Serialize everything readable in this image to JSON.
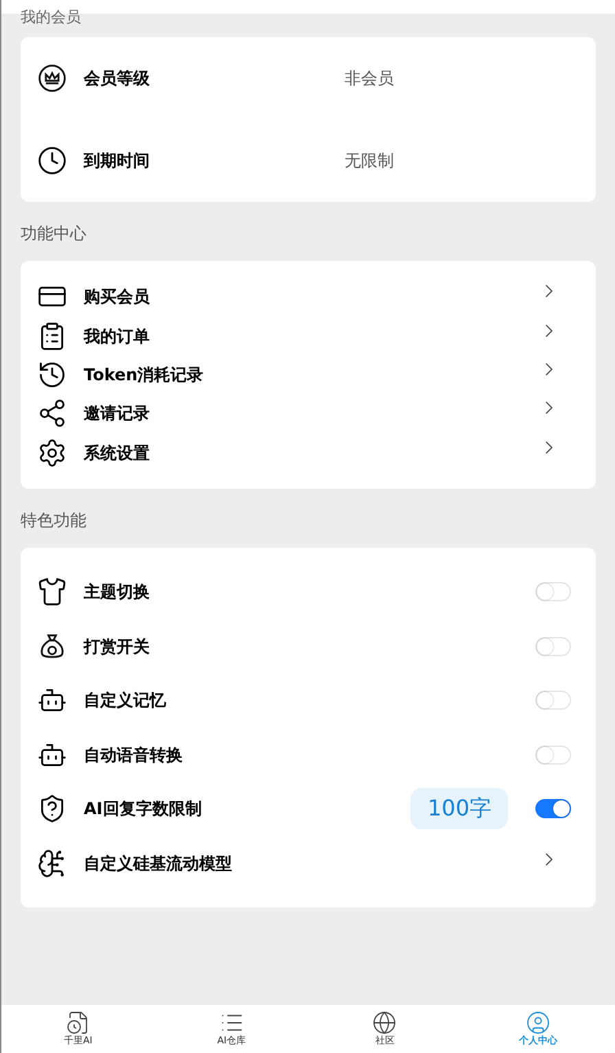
{
  "membership": {
    "title": "我的会员",
    "rows": [
      {
        "label": "会员等级",
        "value": "非会员"
      },
      {
        "label": "到期时间",
        "value": "无限制"
      }
    ]
  },
  "function_center": {
    "title": "功能中心",
    "items": [
      {
        "label": "购买会员"
      },
      {
        "label": "我的订单"
      },
      {
        "label": "Token消耗记录"
      },
      {
        "label": "邀请记录"
      },
      {
        "label": "系统设置"
      }
    ]
  },
  "features": {
    "title": "特色功能",
    "items": [
      {
        "kind": "toggle",
        "label": "主题切换",
        "on": false
      },
      {
        "kind": "toggle",
        "label": "打赏开关",
        "on": false
      },
      {
        "kind": "toggle",
        "label": "自定义记忆",
        "on": false
      },
      {
        "kind": "toggle",
        "label": "自动语音转换",
        "on": false
      },
      {
        "kind": "toggle",
        "label": "AI回复字数限制",
        "badge": "100字",
        "on": true
      },
      {
        "kind": "link",
        "label": "自定义硅基流动模型"
      }
    ]
  },
  "tab_bar": [
    {
      "label": "千里AI",
      "selected": false
    },
    {
      "label": "AI仓库",
      "selected": false
    },
    {
      "label": "社区",
      "selected": false
    },
    {
      "label": "个人中心",
      "selected": true
    }
  ]
}
